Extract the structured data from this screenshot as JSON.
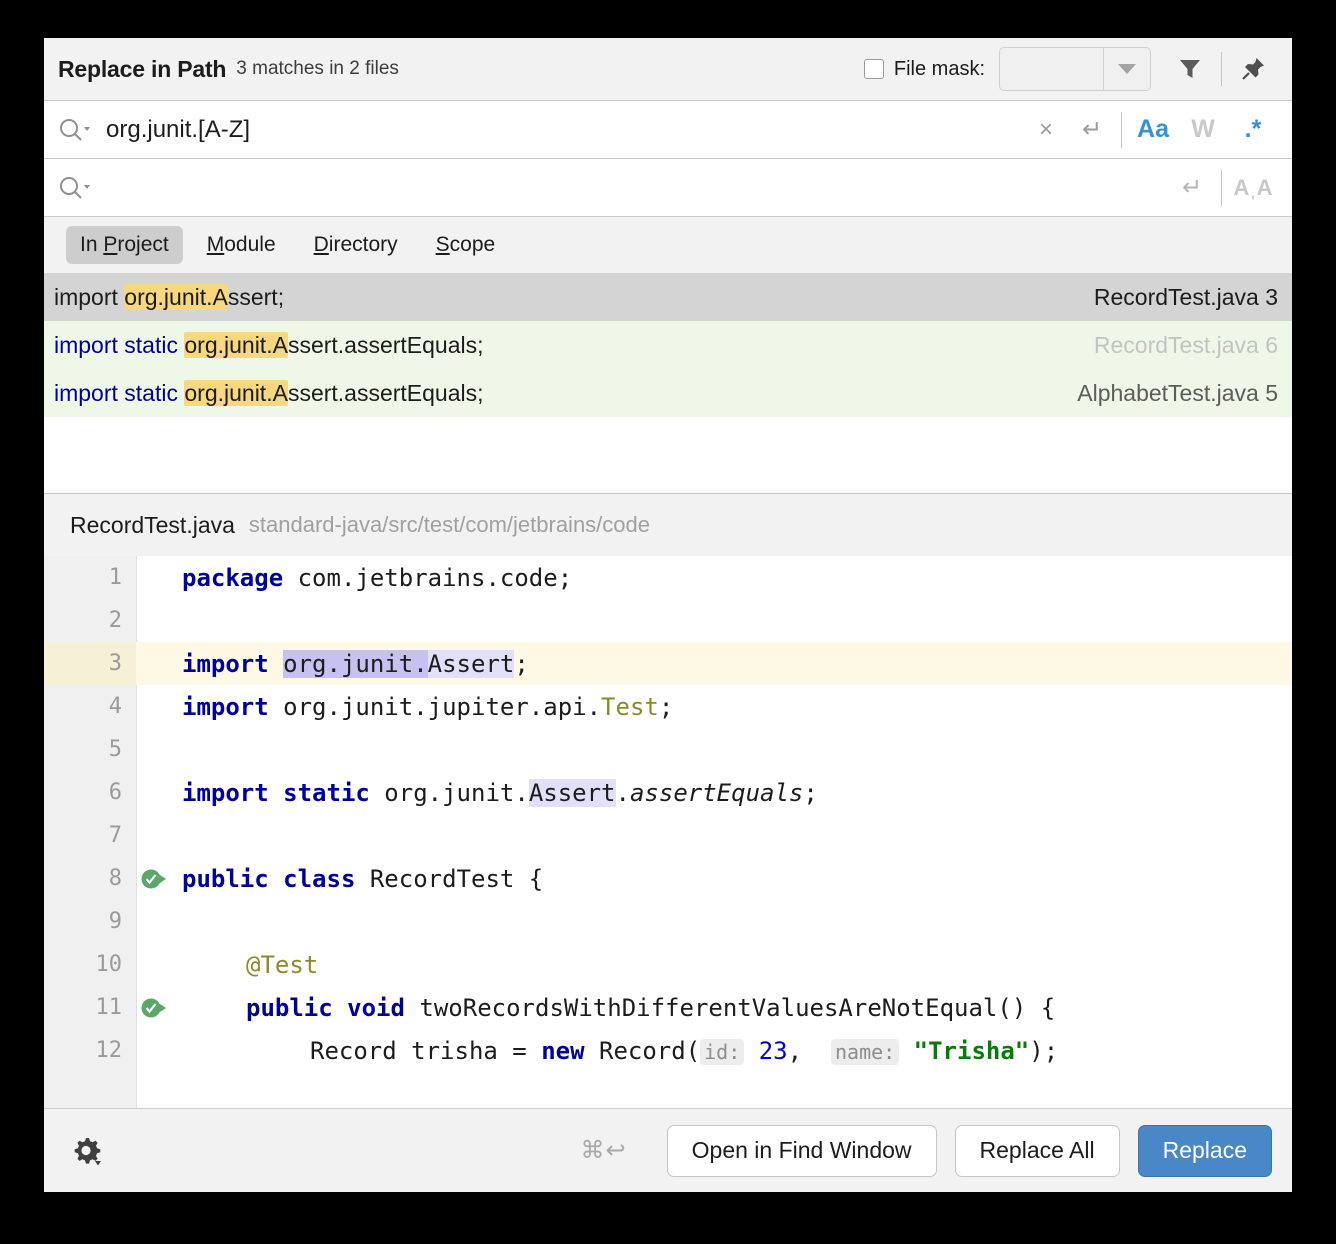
{
  "header": {
    "title": "Replace in Path",
    "subtitle": "3 matches in 2 files",
    "file_mask_label": "File mask:",
    "file_mask_value": "",
    "filter_icon": "filter-icon",
    "pin_icon": "pin-icon"
  },
  "search": {
    "value": "org.junit.[A-Z]",
    "placeholder": "",
    "clear_label": "×",
    "newline_label": "↵",
    "toggles": [
      {
        "name": "match-case",
        "label": "Aa",
        "active": true
      },
      {
        "name": "words",
        "label": "W",
        "active": false
      },
      {
        "name": "regex",
        "label": ".*",
        "active": true
      }
    ]
  },
  "replace": {
    "value": "",
    "placeholder": "",
    "newline_label": "↵",
    "preserve_case_label": "AˌA"
  },
  "scope": {
    "tabs": [
      {
        "label_pre": "In ",
        "mnemonic": "P",
        "label_post": "roject",
        "active": true
      },
      {
        "label_pre": "",
        "mnemonic": "M",
        "label_post": "odule",
        "active": false
      },
      {
        "label_pre": "",
        "mnemonic": "D",
        "label_post": "irectory",
        "active": false
      },
      {
        "label_pre": "",
        "mnemonic": "S",
        "label_post": "cope",
        "active": false
      }
    ]
  },
  "results": {
    "rows": [
      {
        "selected": true,
        "pre_kw": "",
        "text_before": "import ",
        "match": "org.junit.A",
        "text_after": "ssert;",
        "file": "RecordTest.java 3",
        "file_style": "strong"
      },
      {
        "selected": false,
        "pre_kw": "import static ",
        "text_before": "",
        "match": "org.junit.A",
        "text_after": "ssert.assertEquals;",
        "file": "RecordTest.java 6",
        "file_style": "faint"
      },
      {
        "selected": false,
        "pre_kw": "import static ",
        "text_before": "",
        "match": "org.junit.A",
        "text_after": "ssert.assertEquals;",
        "file": "AlphabetTest.java 5",
        "file_style": "normal"
      }
    ]
  },
  "preview": {
    "file_name": "RecordTest.java",
    "file_path": "standard-java/src/test/com/jetbrains/code",
    "lines": [
      {
        "num": "1",
        "current": false,
        "run_icon": false
      },
      {
        "num": "2",
        "current": false,
        "run_icon": false
      },
      {
        "num": "3",
        "current": true,
        "run_icon": false
      },
      {
        "num": "4",
        "current": false,
        "run_icon": false
      },
      {
        "num": "5",
        "current": false,
        "run_icon": false
      },
      {
        "num": "6",
        "current": false,
        "run_icon": false
      },
      {
        "num": "7",
        "current": false,
        "run_icon": false
      },
      {
        "num": "8",
        "current": false,
        "run_icon": true
      },
      {
        "num": "9",
        "current": false,
        "run_icon": false
      },
      {
        "num": "10",
        "current": false,
        "run_icon": false
      },
      {
        "num": "11",
        "current": false,
        "run_icon": true
      },
      {
        "num": "12",
        "current": false,
        "run_icon": false
      }
    ],
    "code": {
      "l1_kw": "package",
      "l1_rest": " com.jetbrains.code;",
      "l3_kw": "import",
      "l3_match_dark": "org.junit.",
      "l3_match_light": "Assert",
      "l3_tail": ";",
      "l4_kw": "import",
      "l4_rest": " org.junit.jupiter.api.",
      "l4_type": "Test",
      "l4_tail": ";",
      "l6_kw": "import",
      "l6_kw2": "static",
      "l6_mid": " org.junit.",
      "l6_match_light": "Assert",
      "l6_dot": ".",
      "l6_italic": "assertEquals",
      "l6_tail": ";",
      "l8_kw": "public",
      "l8_kw2": "class",
      "l8_rest": " RecordTest {",
      "l10_ann": "@Test",
      "l11_kw": "public",
      "l11_kw2": "void",
      "l11_rest": " twoRecordsWithDifferentValuesAreNotEqual() {",
      "l12_pre": "Record trisha = ",
      "l12_kw": "new",
      "l12_mid": " Record(",
      "l12_hint1": "id:",
      "l12_num": "23",
      "l12_comma": ",",
      "l12_hint2": "name:",
      "l12_str": "\"Trisha\"",
      "l12_tail": ");"
    }
  },
  "footer": {
    "settings_icon": "gear-icon",
    "shortcut": "⌘↩",
    "open_in_find_window": "Open in Find Window",
    "replace_all": "Replace All",
    "replace": "Replace"
  },
  "colors": {
    "accent": "#4a87c6",
    "toggle_active": "#3592d8",
    "match_highlight": "#f7d87f",
    "row_selected": "#d4d4d4",
    "row_alt": "#eef7e8",
    "editor_match_dark": "#c5c2f0",
    "editor_match_light": "#e2e0f8",
    "current_line": "#fdf9e4"
  }
}
